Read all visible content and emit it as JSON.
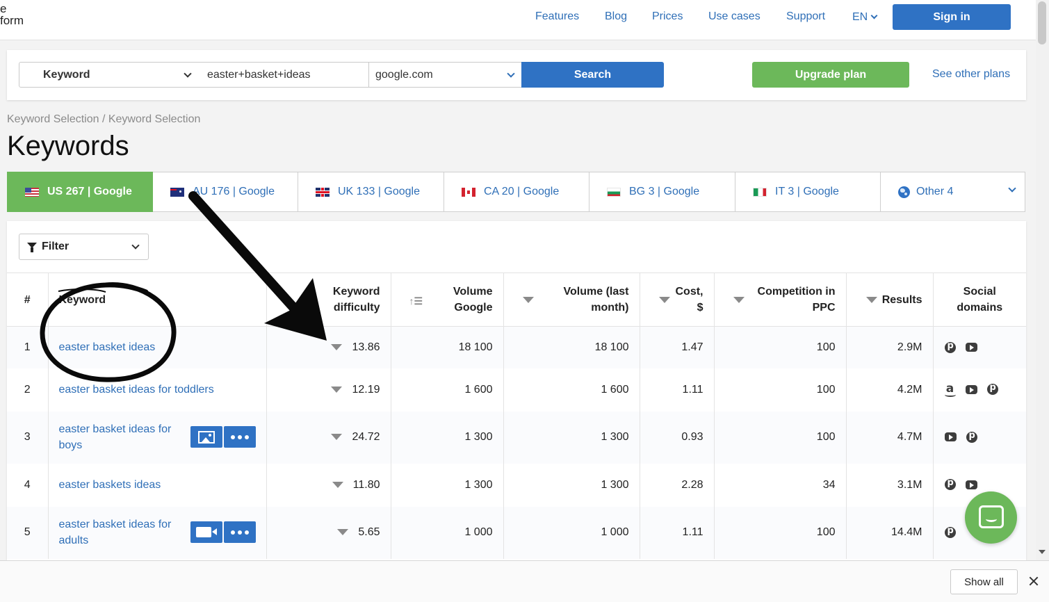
{
  "header": {
    "logo_line1": "e",
    "logo_line2": "form",
    "nav": [
      "Features",
      "Blog",
      "Prices",
      "Use cases",
      "Support"
    ],
    "language": "EN",
    "signin_label": "Sign in"
  },
  "search": {
    "type_value": "Keyword",
    "query_value": "easter+basket+ideas",
    "domain_value": "google.com",
    "search_label": "Search",
    "upgrade_label": "Upgrade plan",
    "other_plans_label": "See other plans"
  },
  "breadcrumb": "Keyword Selection / Keyword Selection",
  "page_title": "Keywords",
  "tabs": [
    {
      "flag": "us",
      "label": "US 267 | Google",
      "active": true
    },
    {
      "flag": "au",
      "label": "AU 176 | Google"
    },
    {
      "flag": "uk",
      "label": "UK 133 | Google"
    },
    {
      "flag": "ca",
      "label": "CA 20 | Google"
    },
    {
      "flag": "bg",
      "label": "BG 3 | Google"
    },
    {
      "flag": "it",
      "label": "IT 3 | Google"
    },
    {
      "flag": "globe",
      "label": "Other 4"
    }
  ],
  "filter_label": "Filter",
  "table": {
    "headers": {
      "num": "#",
      "keyword": "Keyword",
      "difficulty_1": "Keyword",
      "difficulty_2": "difficulty",
      "volume_google_1": "Volume",
      "volume_google_2": "Google",
      "volume_last_1": "Volume (last",
      "volume_last_2": "month)",
      "cost_1": "Cost,",
      "cost_2": "$",
      "competition_1": "Competition in",
      "competition_2": "PPC",
      "results": "Results",
      "social_1": "Social",
      "social_2": "domains"
    },
    "rows": [
      {
        "num": "1",
        "keyword": "easter basket ideas",
        "difficulty": "13.86",
        "volume_google": "18 100",
        "volume_last": "18 100",
        "cost": "1.47",
        "competition": "100",
        "results": "2.9M",
        "social": [
          "pinterest",
          "youtube"
        ],
        "actions": []
      },
      {
        "num": "2",
        "keyword": "easter basket ideas for toddlers",
        "difficulty": "12.19",
        "volume_google": "1 600",
        "volume_last": "1 600",
        "cost": "1.11",
        "competition": "100",
        "results": "4.2M",
        "social": [
          "amazon",
          "youtube",
          "pinterest"
        ],
        "actions": []
      },
      {
        "num": "3",
        "keyword": "easter basket ideas for boys",
        "difficulty": "24.72",
        "volume_google": "1 300",
        "volume_last": "1 300",
        "cost": "0.93",
        "competition": "100",
        "results": "4.7M",
        "social": [
          "youtube",
          "pinterest"
        ],
        "actions": [
          "image",
          "more"
        ]
      },
      {
        "num": "4",
        "keyword": "easter baskets ideas",
        "difficulty": "11.80",
        "volume_google": "1 300",
        "volume_last": "1 300",
        "cost": "2.28",
        "competition": "34",
        "results": "3.1M",
        "social": [
          "pinterest",
          "youtube"
        ],
        "actions": []
      },
      {
        "num": "5",
        "keyword": "easter basket ideas for adults",
        "difficulty": "5.65",
        "volume_google": "1 000",
        "volume_last": "1 000",
        "cost": "1.11",
        "competition": "100",
        "results": "14.4M",
        "social": [
          "pinterest"
        ],
        "actions": [
          "video",
          "more"
        ]
      }
    ]
  },
  "bottom": {
    "show_all_label": "Show all"
  },
  "colors": {
    "accent_blue": "#2f72c4",
    "link_blue": "#2f6fb7",
    "accent_green": "#6cb85a"
  }
}
